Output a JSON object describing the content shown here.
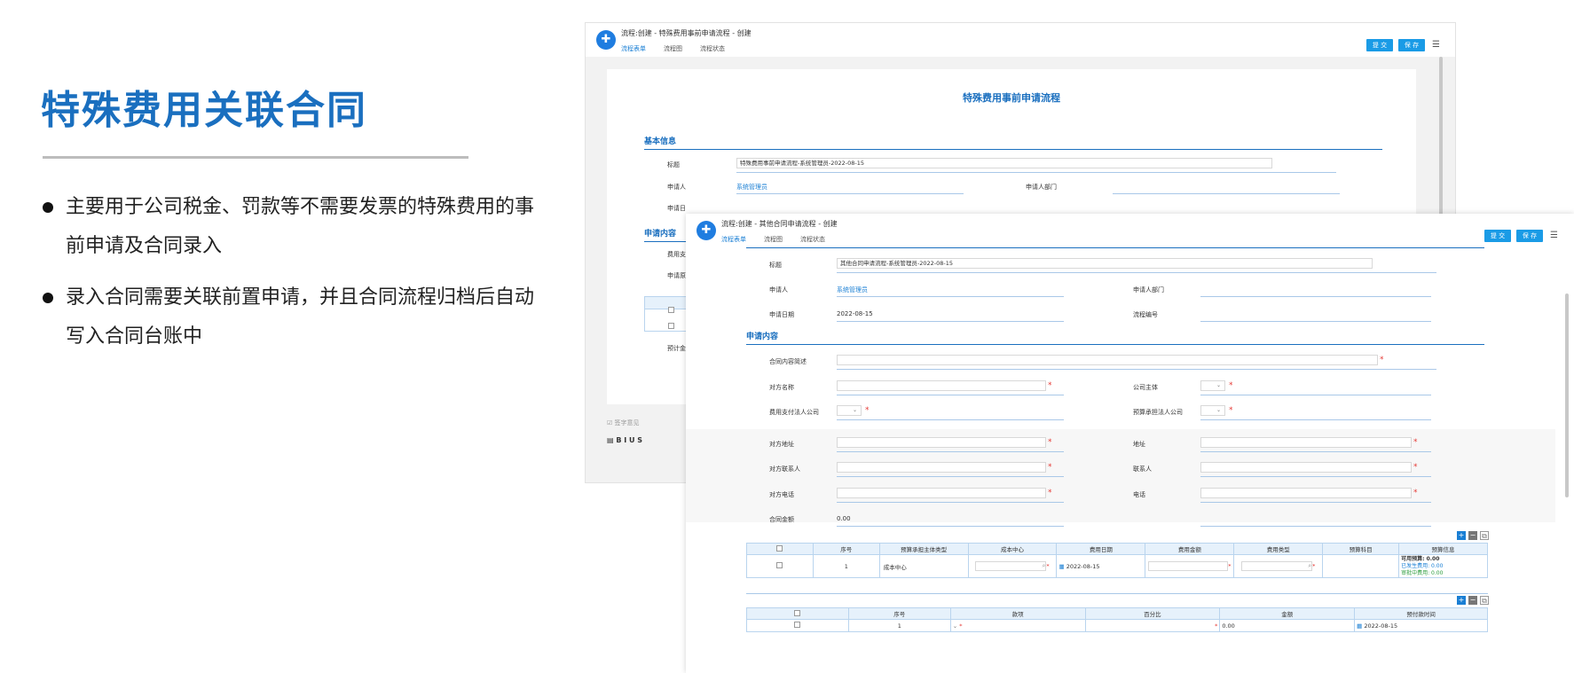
{
  "slide": {
    "title": "特殊费用关联合同",
    "bullets": [
      "主要用于公司税金、罚款等不需要发票的特殊费用的事前申请及合同录入",
      "录入合同需要关联前置申请，并且合同流程归档后自动写入合同台账中"
    ]
  },
  "win1": {
    "title": "流程:创建 - 特殊费用事前申请流程 - 创建",
    "tabs": [
      "流程表单",
      "流程图",
      "流程状态"
    ],
    "submit": "提 交",
    "save": "保 存",
    "form_title": "特殊费用事前申请流程",
    "section_basic": "基本信息",
    "label_title": "标题",
    "value_title": "特殊费用事前申请流程-系统管理员-2022-08-15",
    "label_applicant": "申请人",
    "value_applicant": "系统管理员",
    "label_dept": "申请人部门",
    "label_date_part": "申请日",
    "section_content": "申请内容",
    "label_fee_part": "费用支",
    "label_apply_part": "申请原",
    "label_budget_part": "预计金",
    "editor_hint": "签字意见",
    "editor_tools": "B I U S"
  },
  "win2": {
    "title": "流程:创建 - 其他合同申请流程 - 创建",
    "tabs": [
      "流程表单",
      "流程图",
      "流程状态"
    ],
    "submit": "提 交",
    "save": "保 存",
    "label_title": "标题",
    "value_title": "其他合同申请流程-系统管理员-2022-08-15",
    "label_applicant": "申请人",
    "value_applicant": "系统管理员",
    "label_dept": "申请人部门",
    "label_date": "申请日期",
    "value_date": "2022-08-15",
    "label_flowno": "流程编号",
    "section_content": "申请内容",
    "label_contract_desc": "合同内容简述",
    "label_party_name": "对方名称",
    "label_company": "公司主体",
    "label_pay_company": "费用支付法人公司",
    "label_budget_company": "预算承担法人公司",
    "label_party_addr": "对方地址",
    "label_addr": "地址",
    "label_party_contact": "对方联系人",
    "label_contact": "联系人",
    "label_party_phone": "对方电话",
    "label_phone": "电话",
    "label_amount": "合同金额",
    "value_amount": "0.00",
    "grid1": {
      "headers": [
        "",
        "序号",
        "预算承担主体类型",
        "成本中心",
        "费用日期",
        "费用金额",
        "费用类型",
        "预算科目",
        "预算信息"
      ],
      "row": {
        "no": "1",
        "type": "成本中心",
        "date": "2022-08-15",
        "budget_avail": "可用预算: 0.00",
        "budget_used": "已发生费用: 0.00",
        "budget_pending": "审批中费用: 0.00"
      }
    },
    "grid2": {
      "headers": [
        "",
        "序号",
        "款项",
        "百分比",
        "金额",
        "预付款时间"
      ],
      "row": {
        "no": "1",
        "amount": "0.00",
        "date": "2022-08-15"
      }
    }
  }
}
